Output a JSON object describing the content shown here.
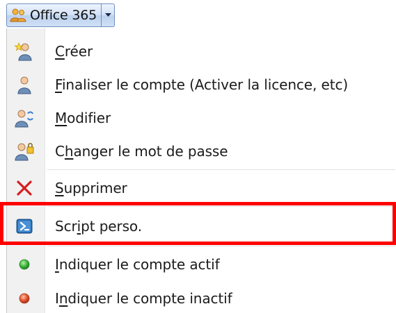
{
  "toolbar": {
    "button_label": "Office 365",
    "button_icon": "users-group-icon",
    "dropdown_icon": "chevron-down-icon"
  },
  "menu": {
    "items": [
      {
        "id": "creer",
        "pre": "",
        "accel": "C",
        "post": "réer",
        "icon": "user-add-icon"
      },
      {
        "id": "finaliser",
        "pre": "",
        "accel": "F",
        "post": "inaliser le compte (Activer la licence, etc)",
        "icon": "user-icon"
      },
      {
        "id": "modifier",
        "pre": "",
        "accel": "M",
        "post": "odifier",
        "icon": "user-edit-icon"
      },
      {
        "id": "changer-mdp",
        "pre": "C",
        "accel": "h",
        "post": "anger le mot de passe",
        "icon": "user-key-icon"
      },
      {
        "id": "supprimer",
        "pre": "",
        "accel": "S",
        "post": "upprimer",
        "icon": "delete-x-icon"
      },
      {
        "id": "script",
        "pre": "Scr",
        "accel": "i",
        "post": "pt perso.",
        "icon": "powershell-icon"
      },
      {
        "id": "actif",
        "pre": "",
        "accel": "I",
        "post": "ndiquer le compte actif",
        "icon": "green-dot-icon"
      },
      {
        "id": "inactif",
        "pre": "I",
        "accel": "n",
        "post": "diquer le compte inactif",
        "icon": "red-dot-icon"
      }
    ]
  },
  "highlight": {
    "color": "#ff0000",
    "target": "script"
  },
  "colors": {
    "accent_border": "#6f8fbf",
    "gutter": "#f1f1f1",
    "delete_red": "#d81e1e",
    "active_green": "#3ab53a",
    "inactive_red": "#e0532b"
  }
}
